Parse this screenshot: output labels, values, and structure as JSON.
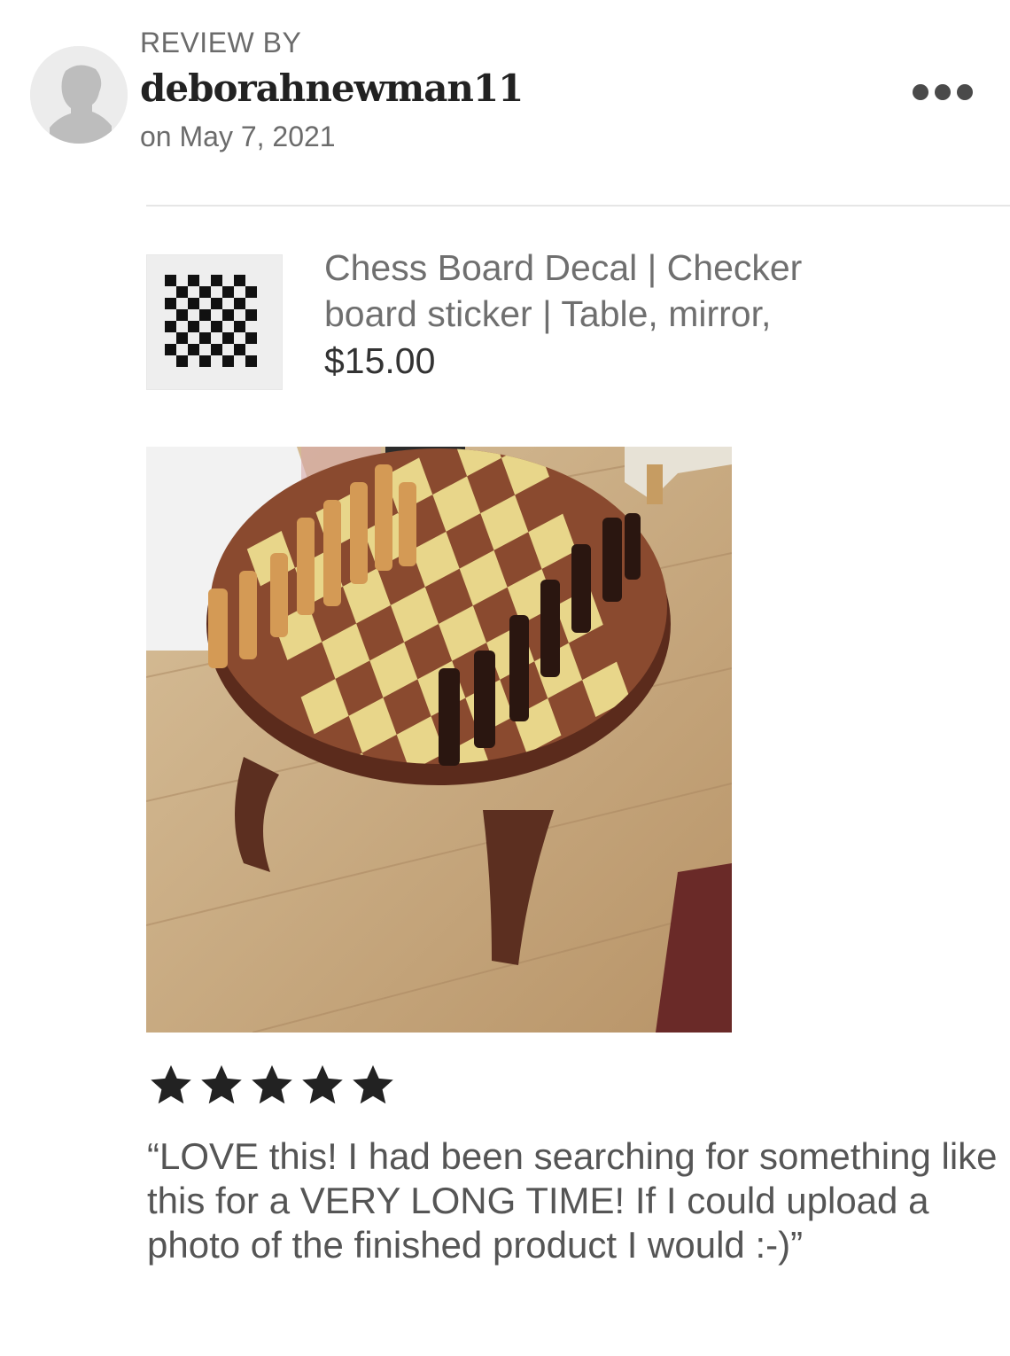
{
  "header": {
    "label": "REVIEW BY",
    "username": "deborahnewman11",
    "date": "on May 7, 2021",
    "more_icon": "more-horizontal-icon"
  },
  "product": {
    "title": "Chess Board Decal | Checker board sticker | Table, mirror,",
    "price": "$15.00"
  },
  "review": {
    "rating": 5,
    "rating_max": 5,
    "text": "“LOVE this! I had been searching for something like this for a VERY LONG TIME! If I could upload a photo of the finished product I would :-)”"
  },
  "colors": {
    "star": "#222222",
    "muted_text": "#6b6b6b",
    "divider": "#e6e6e6"
  }
}
